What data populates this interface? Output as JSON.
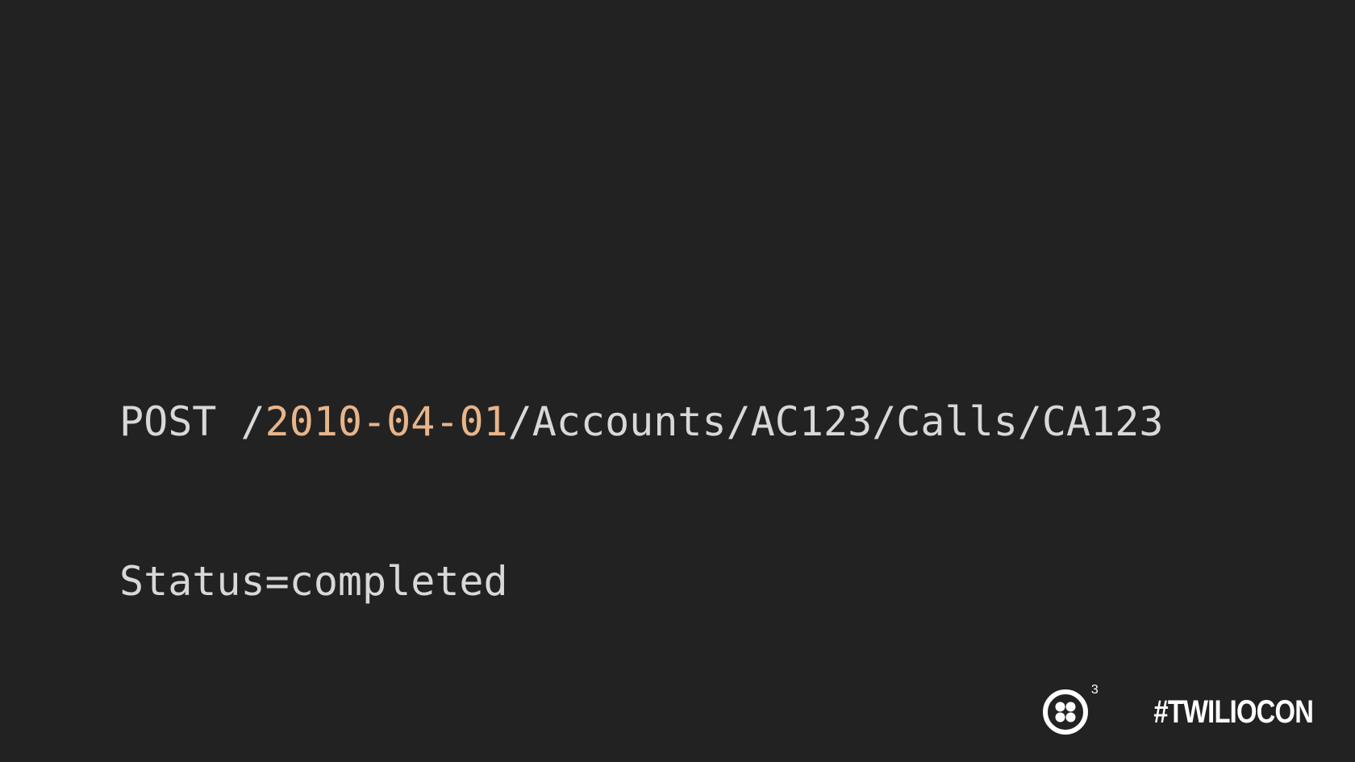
{
  "code": {
    "line1": {
      "prefix": "POST /",
      "version": "2010-04-01",
      "suffix": "/Accounts/AC123/Calls/CA123"
    },
    "line2": "Status=completed"
  },
  "brand": {
    "logo_icon": "twilio-logo-icon",
    "superscript": "3",
    "hashtag": "#TWILIOCON"
  },
  "colors": {
    "background": "#222222",
    "code_text": "#d8d8d8",
    "version_highlight": "#e8b48a",
    "brand": "#ffffff"
  }
}
